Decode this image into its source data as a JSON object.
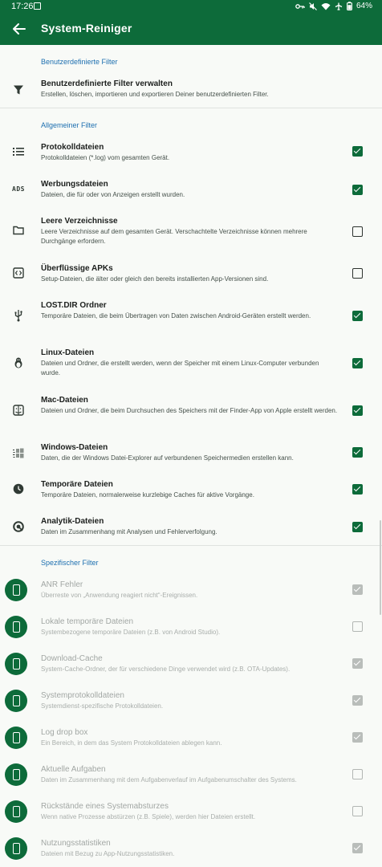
{
  "status": {
    "time": "17:26",
    "battery": "64%"
  },
  "appbar": {
    "title": "System-Reiniger"
  },
  "sections": {
    "custom": "Benutzerdefinierte Filter",
    "general": "Allgemeiner Filter",
    "specific": "Spezifischer Filter"
  },
  "custom_filter": {
    "title": "Benutzerdefinierte Filter verwalten",
    "summary": "Erstellen, löschen, importieren und exportieren Deiner benutzerdefinierten Filter.",
    "icon": "filter-icon"
  },
  "general_filters": [
    {
      "title": "Protokolldateien",
      "summary": "Protokolldateien (*.log) vom gesamten Gerät.",
      "checked": true,
      "icon": "list-icon"
    },
    {
      "title": "Werbungsdateien",
      "summary": "Dateien, die für oder von Anzeigen erstellt wurden.",
      "checked": true,
      "icon": "ads-icon",
      "icon_text": "ADS"
    },
    {
      "title": "Leere Verzeichnisse",
      "summary": "Leere Verzeichnisse auf dem gesamten Gerät. Verschachtelte Verzeichnisse können mehrere Durchgänge erfordern.",
      "checked": false,
      "icon": "folder-icon"
    },
    {
      "title": "Überflüssige APKs",
      "summary": "Setup-Dateien, die älter oder gleich den bereits installierten App-Versionen sind.",
      "checked": false,
      "icon": "apk-icon"
    },
    {
      "title": "LOST.DIR Ordner",
      "summary": "Temporäre Dateien, die beim Übertragen von Daten zwischen Android-Geräten erstellt werden.",
      "checked": true,
      "icon": "usb-icon"
    },
    {
      "title": "Linux-Dateien",
      "summary": "Dateien und Ordner, die erstellt werden, wenn der Speicher mit einem Linux-Computer verbunden wurde.",
      "checked": true,
      "icon": "linux-icon"
    },
    {
      "title": "Mac-Dateien",
      "summary": "Dateien und Ordner, die beim Durchsuchen des Speichers mit der Finder-App von Apple erstellt werden.",
      "checked": true,
      "icon": "finder-icon"
    },
    {
      "title": "Windows-Dateien",
      "summary": "Daten, die der Windows Datei-Explorer auf verbundenen Speichermedien erstellen kann.",
      "checked": true,
      "icon": "windows-icon"
    },
    {
      "title": "Temporäre Dateien",
      "summary": "Temporäre Dateien, normalerweise kurzlebige Caches für aktive Vorgänge.",
      "checked": true,
      "icon": "clock-icon"
    },
    {
      "title": "Analytik-Dateien",
      "summary": "Daten im Zusammenhang mit Analysen und Fehlerverfolgung.",
      "checked": true,
      "icon": "analytics-icon"
    }
  ],
  "specific_filters": [
    {
      "title": "ANR Fehler",
      "summary": "Überreste von „Anwendung reagiert nicht“-Ereignissen.",
      "checked": true
    },
    {
      "title": "Lokale temporäre Dateien",
      "summary": "Systembezogene temporäre Dateien (z.B. von Android Studio).",
      "checked": false
    },
    {
      "title": "Download-Cache",
      "summary": "System-Cache-Ordner, der für verschiedene Dinge verwendet wird (z.B. OTA-Updates).",
      "checked": true
    },
    {
      "title": "Systemprotokolldateien",
      "summary": "Systemdienst-spezifische Protokolldateien.",
      "checked": true
    },
    {
      "title": "Log drop box",
      "summary": "Ein Bereich, in dem das System Protokolldateien ablegen kann.",
      "checked": true
    },
    {
      "title": "Aktuelle Aufgaben",
      "summary": "Daten im Zusammenhang mit dem Aufgabenverlauf im Aufgabenumschalter des Systems.",
      "checked": false
    },
    {
      "title": "Rückstände eines Systemabsturzes",
      "summary": "Wenn native Prozesse abstürzen (z.B. Spiele), werden hier Dateien erstellt.",
      "checked": false
    },
    {
      "title": "Nutzungsstatistiken",
      "summary": "Dateien mit Bezug zu App-Nutzungsstatistiken.",
      "checked": true
    }
  ]
}
